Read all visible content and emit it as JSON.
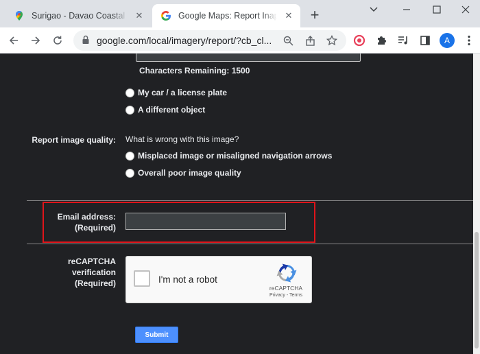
{
  "browser": {
    "tabs": [
      {
        "title": "Surigao - Davao Coastal Rd",
        "icon": "google-maps-pin-icon",
        "active": false
      },
      {
        "title": "Google Maps: Report Inapp",
        "icon": "google-g-icon",
        "active": true
      }
    ],
    "close_glyph": "✕",
    "new_tab_glyph": "+",
    "url": "google.com/local/imagery/report/?cb_cl...",
    "profile_initial": "A",
    "accent": "#1a73e8"
  },
  "form": {
    "chars_remaining": "Characters Remaining: 1500",
    "object_options": [
      "My car / a license plate",
      "A different object"
    ],
    "quality_label": "Report image quality:",
    "quality_question": "What is wrong with this image?",
    "quality_options": [
      "Misplaced image or misaligned navigation arrows",
      "Overall poor image quality"
    ],
    "email_label": "Email address:",
    "email_required": "(Required)",
    "email_value": "",
    "recaptcha_label_1": "reCAPTCHA",
    "recaptcha_label_2": "verification",
    "recaptcha_required": "(Required)",
    "recaptcha_checkbox_text": "I'm not a robot",
    "recaptcha_brand": "reCAPTCHA",
    "recaptcha_links": "Privacy - Terms",
    "submit_label": "Submit",
    "highlight_color": "#e0141a"
  }
}
